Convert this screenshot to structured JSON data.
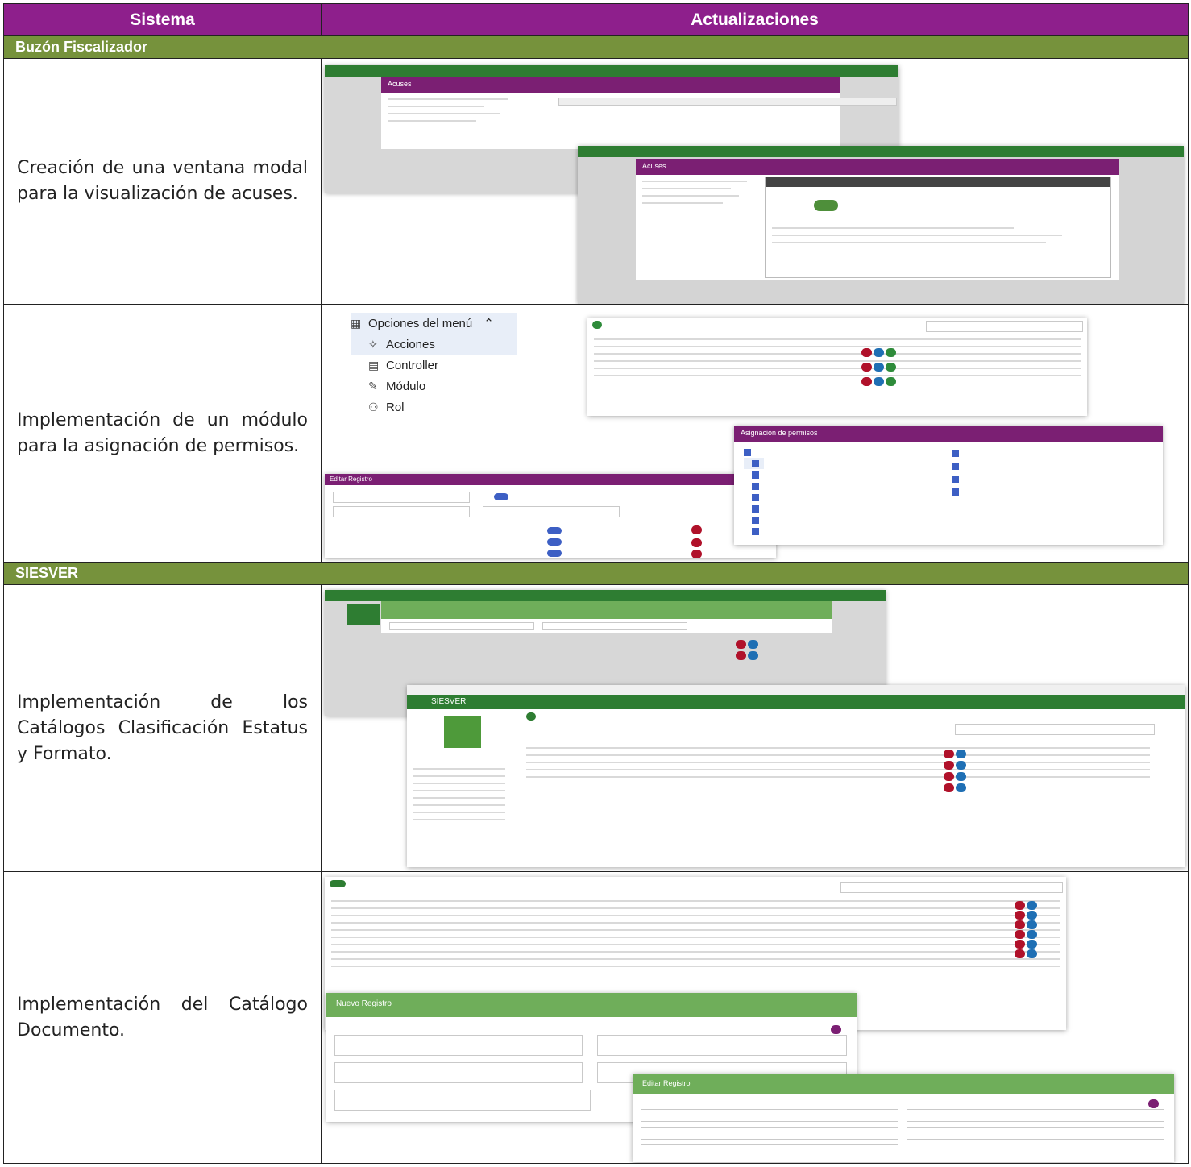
{
  "header": {
    "col_system": "Sistema",
    "col_updates": "Actualizaciones"
  },
  "sections": [
    {
      "title": "Buzón Fiscalizador",
      "rows": [
        {
          "description": "Creación de una ventana modal para la visualización de acuses."
        },
        {
          "description": "Implementación de un módulo para la asignación de permisos."
        }
      ]
    },
    {
      "title": "SIESVER",
      "rows": [
        {
          "description": "Implementación de los Catálogos Clasificación Estatus y Formato."
        },
        {
          "description": "Implementación del Catálogo Documento."
        }
      ]
    }
  ],
  "screens": {
    "acuses": {
      "modal_title": "Acuses",
      "app_title": "Buzón Fiscalizador"
    },
    "permisos": {
      "menu_title": "Opciones del menú",
      "menu_items": [
        "Acciones",
        "Controller",
        "Módulo",
        "Rol"
      ],
      "perm_modal_title": "Asignación de permisos",
      "edit_modal_title": "Editar Registro"
    },
    "formato": {
      "app_title": "SIESVER",
      "modal_title": "Nuevo Registro"
    },
    "documento": {
      "new_modal_title": "Nuevo Registro",
      "edit_modal_title": "Editar Registro"
    }
  },
  "colors": {
    "header": "#8e1f8c",
    "section": "#76923c",
    "app_green": "#2e7d32",
    "modal_purple": "#7b1f73"
  }
}
